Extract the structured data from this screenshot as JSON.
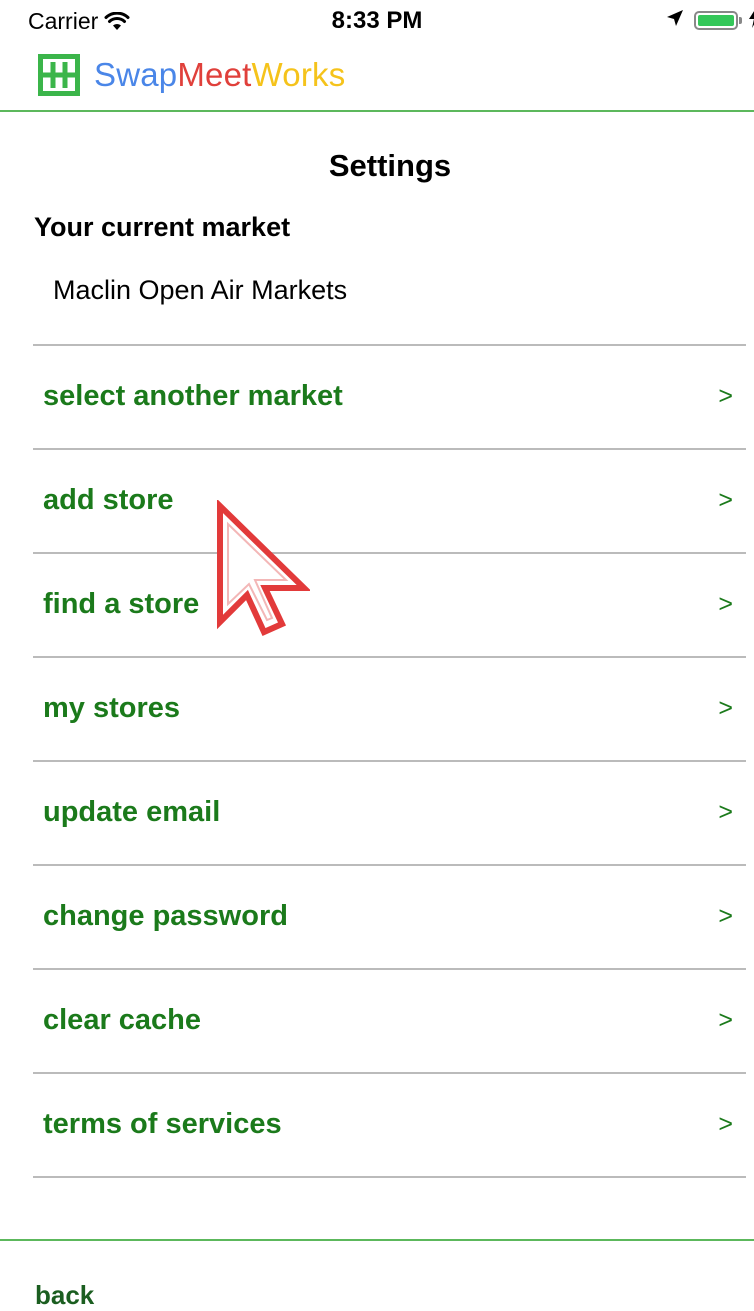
{
  "status_bar": {
    "carrier": "Carrier",
    "time": "8:33 PM",
    "icons": [
      "wifi-icon",
      "location-icon",
      "battery-icon",
      "charging-icon"
    ]
  },
  "header": {
    "brand_part1": "Swap",
    "brand_part2": "Meet",
    "brand_part3": "Works",
    "logo_icon": "market-grid-icon",
    "colors": {
      "swap": "#4a86e8",
      "meet": "#e0403b",
      "works": "#f5c31b",
      "accent": "#5cb85c"
    }
  },
  "page": {
    "title": "Settings",
    "current_market_label": "Your current market",
    "current_market_value": "Maclin Open Air Markets"
  },
  "menu": {
    "chevron": ">",
    "items": [
      {
        "label": "select another market"
      },
      {
        "label": "add store"
      },
      {
        "label": "find a store"
      },
      {
        "label": "my stores"
      },
      {
        "label": "update email"
      },
      {
        "label": "change password"
      },
      {
        "label": "clear cache"
      },
      {
        "label": "terms of services"
      }
    ],
    "text_color": "#1b7a1b"
  },
  "footer": {
    "back_label": "back"
  }
}
